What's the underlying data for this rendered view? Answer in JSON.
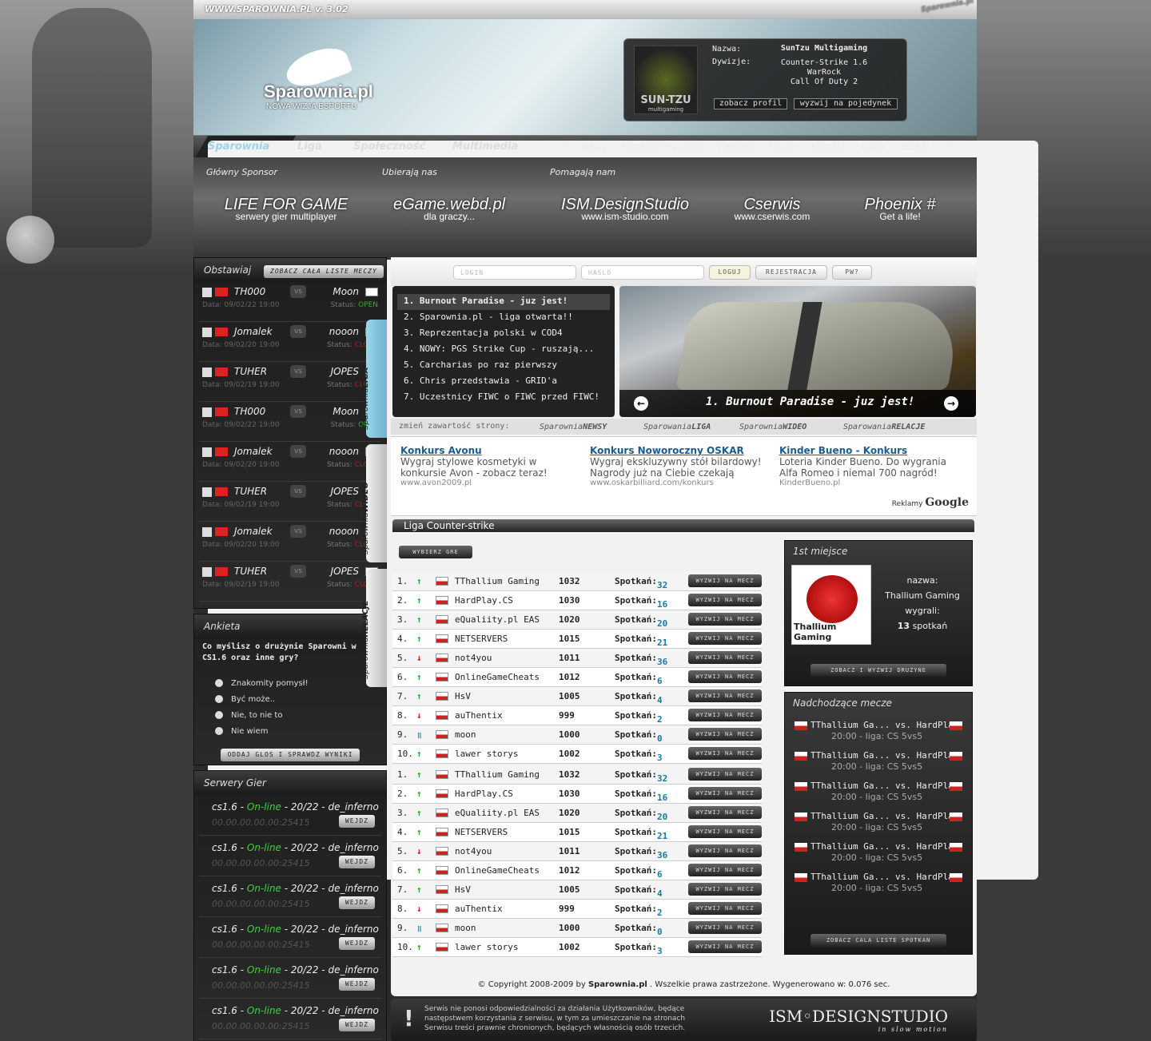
{
  "site": {
    "url": "WWW.SPAROWNIA.PL",
    "version": "v. 3.02",
    "logo_name": "Sparownia.pl",
    "logo_tagline": "NOWA WIZJA ESPORTU",
    "watermark": "Sparownia.pl"
  },
  "profile": {
    "name_label": "Nazwa:",
    "name": "SunTzu Multigaming",
    "div_label": "Dywizje:",
    "divisions": [
      "Counter-Strike 1.6",
      "WarRock",
      "Call Of Duty 2"
    ],
    "logo": "SUN-TZU",
    "logo_sub": "multigaming",
    "btn_view": "zobacz profil",
    "btn_challenge": "wyzwij na pojedynek"
  },
  "nav": {
    "main": [
      "Sparownia",
      "Liga",
      "Społeczność",
      "Multimedia"
    ],
    "sep": "//",
    "sub": [
      "News",
      "Archiwum newsów",
      "Zakłady",
      "Forum",
      "Kontakt",
      "Ekipa",
      "Szukaj"
    ],
    "sep2": "//"
  },
  "sponsors": {
    "headers": [
      "Główny Sponsor",
      "Ubierają nas",
      "Pomagają nam"
    ],
    "items": [
      {
        "name": "LIFE FOR GAME",
        "desc": "serwery gier multiplayer"
      },
      {
        "name": "eGame.webd.pl",
        "desc": "dla graczy..."
      },
      {
        "name": "ISM.DesignStudio",
        "desc": "www.ism-studio.com"
      },
      {
        "name": "Cserwis",
        "desc": "www.cserwis.com"
      },
      {
        "name": "Phoenix #",
        "desc": "Get a life!"
      }
    ]
  },
  "bet": {
    "title": "Obstawiaj",
    "button": "ZOBACZ CAŁA LISTE MECZY",
    "vs": "vs",
    "date_prefix": "Data:",
    "status_prefix": "Status:",
    "matches": [
      {
        "a": "TH000",
        "b": "Moon",
        "date": "09/02/22 19:00",
        "status": "OPEN",
        "open": true
      },
      {
        "a": "Jomalek",
        "b": "nooon",
        "date": "09/02/20 19:00",
        "status": "CLOSE",
        "open": false
      },
      {
        "a": "TUHER",
        "b": "JOPES",
        "date": "09/02/19 19:00",
        "status": "CLOSE",
        "open": false
      },
      {
        "a": "TH000",
        "b": "Moon",
        "date": "09/02/22 19:00",
        "status": "OPEN",
        "open": true
      },
      {
        "a": "Jomalek",
        "b": "nooon",
        "date": "09/02/20 19:00",
        "status": "CLOSE",
        "open": false
      },
      {
        "a": "TUHER",
        "b": "JOPES",
        "date": "09/02/19 19:00",
        "status": "CLOSE",
        "open": false
      },
      {
        "a": "Jomalek",
        "b": "nooon",
        "date": "09/02/20 19:00",
        "status": "CLOSE",
        "open": false
      },
      {
        "a": "TUHER",
        "b": "JOPES",
        "date": "09/02/19 19:00",
        "status": "CLOSE",
        "open": false
      }
    ]
  },
  "vtabs": [
    {
      "a": "Sparownia",
      "b": "LIGA"
    },
    {
      "a": "Sparownia",
      "b": "WIDEO"
    },
    {
      "a": "Sparownia",
      "b": "RELACJE"
    }
  ],
  "poll": {
    "title": "Ankieta",
    "question": "Co myślisz o drużynie Sparowni w CS1.6 oraz inne gry?",
    "options": [
      "Znakomity pomysł!",
      "Być może..",
      "Nie, to nie to",
      "Nie wiem"
    ],
    "button": "ODDAJ GLOS I SPRAWDZ WYNIKI"
  },
  "servers": {
    "title": "Serwery Gier",
    "items": [
      {
        "game": "cs1.6 - ",
        "status": "On-line",
        "rest": " - 20/22 - de_inferno",
        "ip": "00.00.00.00.00:25415",
        "btn": "WEJDZ"
      },
      {
        "game": "cs1.6 - ",
        "status": "On-line",
        "rest": " - 20/22 - de_inferno",
        "ip": "00.00.00.00.00:25415",
        "btn": "WEJDZ"
      },
      {
        "game": "cs1.6 - ",
        "status": "On-line",
        "rest": " - 20/22 - de_inferno",
        "ip": "00.00.00.00.00:25415",
        "btn": "WEJDZ"
      },
      {
        "game": "cs1.6 - ",
        "status": "On-line",
        "rest": " - 20/22 - de_inferno",
        "ip": "00.00.00.00.00:25415",
        "btn": "WEJDZ"
      },
      {
        "game": "cs1.6 - ",
        "status": "On-line",
        "rest": " - 20/22 - de_inferno",
        "ip": "00.00.00.00.00:25415",
        "btn": "WEJDZ"
      },
      {
        "game": "cs1.6 - ",
        "status": "On-line",
        "rest": " - 20/22 - de_inferno",
        "ip": "00.00.00.00.00:25415",
        "btn": "WEJDZ"
      }
    ]
  },
  "login": {
    "login_ph": "LOGIN",
    "pass_ph": "HASLO",
    "btn_login": "LOGUJ",
    "btn_register": "REJESTRACJA",
    "btn_pw": "PW?"
  },
  "news": [
    "1. Burnout Paradise - juz jest!",
    "2. Sparownia.pl - liga otwarta!!",
    "3. Reprezentacja polski w COD4",
    "4. NOWY: PGS Strike Cup - ruszają...",
    "5. Carcharias po raz pierwszy",
    "6. Chris przedstawia - GRID'a",
    "7. Uczestnicy FIWC o FIWC przed FIWC!"
  ],
  "slide": {
    "caption": "1. Burnout Paradise - juz jest!"
  },
  "changer": {
    "label": "zmień zawartość strony:",
    "options": [
      {
        "a": "Sparownia",
        "b": "NEWSY"
      },
      {
        "a": "Sparowania",
        "b": "LIGA"
      },
      {
        "a": "Sparownia",
        "b": "WIDEO"
      },
      {
        "a": "Sparowania",
        "b": "RELACJE"
      }
    ]
  },
  "ads": [
    {
      "title": "Konkurs Avonu",
      "body": "Wygraj stylowe kosmetyki w konkursie Avon - zobacz teraz!",
      "url": "www.avon2009.pl"
    },
    {
      "title": "Konkurs Noworoczny OSKAR",
      "body": "Wygraj ekskluzywny stół bilardowy! Nagrody już na Ciebie czekają",
      "url": "www.oskarbilliard.com/konkurs"
    },
    {
      "title": "Kinder Bueno - Konkurs",
      "body": "Loteria Kinder Bueno. Do wygrania Alfa Romeo i niemal 700 nagród!",
      "url": "KinderBueno.pl"
    }
  ],
  "google": {
    "label": "Reklamy",
    "brand": "Google"
  },
  "league": {
    "title": "Liga Counter-strike",
    "select_btn": "WYBIERZ GRE",
    "meet_label": "Spotkań:",
    "challenge": "WYZWIJ NA MECZ",
    "ranks": [
      {
        "n": "1.",
        "t": "up",
        "name": "TThallium Gaming",
        "pts": "1032",
        "m": "32"
      },
      {
        "n": "2.",
        "t": "up",
        "name": "HardPlay.CS",
        "pts": "1030",
        "m": "16"
      },
      {
        "n": "3.",
        "t": "up",
        "name": "eQualiity.pl EAS",
        "pts": "1020",
        "m": "20"
      },
      {
        "n": "4.",
        "t": "up",
        "name": "NETSERVERS",
        "pts": "1015",
        "m": "21"
      },
      {
        "n": "5.",
        "t": "down",
        "name": "not4you",
        "pts": "1011",
        "m": "36"
      },
      {
        "n": "6.",
        "t": "up",
        "name": "OnlineGameCheats",
        "pts": "1012",
        "m": "6"
      },
      {
        "n": "7.",
        "t": "up",
        "name": "HsV",
        "pts": "1005",
        "m": "4"
      },
      {
        "n": "8.",
        "t": "down",
        "name": "auThentix",
        "pts": "999",
        "m": "2"
      },
      {
        "n": "9.",
        "t": "eq",
        "name": "moon",
        "pts": "1000",
        "m": "0"
      },
      {
        "n": "10.",
        "t": "up",
        "name": "lawer storys",
        "pts": "1002",
        "m": "3"
      },
      {
        "n": "1.",
        "t": "up",
        "name": "TThallium Gaming",
        "pts": "1032",
        "m": "32"
      },
      {
        "n": "2.",
        "t": "up",
        "name": "HardPlay.CS",
        "pts": "1030",
        "m": "16"
      },
      {
        "n": "3.",
        "t": "up",
        "name": "eQualiity.pl EAS",
        "pts": "1020",
        "m": "20"
      },
      {
        "n": "4.",
        "t": "up",
        "name": "NETSERVERS",
        "pts": "1015",
        "m": "21"
      },
      {
        "n": "5.",
        "t": "down",
        "name": "not4you",
        "pts": "1011",
        "m": "36"
      },
      {
        "n": "6.",
        "t": "up",
        "name": "OnlineGameCheats",
        "pts": "1012",
        "m": "6"
      },
      {
        "n": "7.",
        "t": "up",
        "name": "HsV",
        "pts": "1005",
        "m": "4"
      },
      {
        "n": "8.",
        "t": "down",
        "name": "auThentix",
        "pts": "999",
        "m": "2"
      },
      {
        "n": "9.",
        "t": "eq",
        "name": "moon",
        "pts": "1000",
        "m": "0"
      },
      {
        "n": "10.",
        "t": "up",
        "name": "lawer storys",
        "pts": "1002",
        "m": "3"
      }
    ]
  },
  "first": {
    "title": "1st miejsce",
    "name_label": "nazwa:",
    "name": "Thallium Gaming",
    "won_label": "wygrali:",
    "won": "13",
    "won_suffix": "spotkań",
    "logo_label": "Thallium Gaming",
    "button": "ZOBACZ I WYZWIJ DRUZYNE"
  },
  "upcoming": {
    "title": "Nadchodzące mecze",
    "button": "ZOBACZ CALA LISTE SPOTKAN",
    "items": [
      {
        "match": "TThallium Ga... vs. HardPlay",
        "info": "20:00 - liga: CS 5vs5"
      },
      {
        "match": "TThallium Ga... vs. HardPlay",
        "info": "20:00 - liga: CS 5vs5"
      },
      {
        "match": "TThallium Ga... vs. HardPlay",
        "info": "20:00 - liga: CS 5vs5"
      },
      {
        "match": "TThallium Ga... vs. HardPlay",
        "info": "20:00 - liga: CS 5vs5"
      },
      {
        "match": "TThallium Ga... vs. HardPlay",
        "info": "20:00 - liga: CS 5vs5"
      },
      {
        "match": "TThallium Ga... vs. HardPlay",
        "info": "20:00 - liga: CS 5vs5"
      }
    ]
  },
  "copyright": {
    "a": "© Copyright 2008-2009 by ",
    "b": "Sparownia.pl",
    "c": " . Wszelkie prawa zastrzeżone. Wygenerowano w: 0.076 sec."
  },
  "footer": {
    "disclaimer": "Serwis nie ponosi odpowiedzialności za działania Użytkowników, będące następstwem korzystania z serwisu, w tym za umieszczanie na stronach Serwisu treści prawnie chronionych, będących własnością osób trzecich.",
    "brand": "ISM",
    "brand2": "DESIGNSTUDIO",
    "slogan": "in slow motion"
  }
}
